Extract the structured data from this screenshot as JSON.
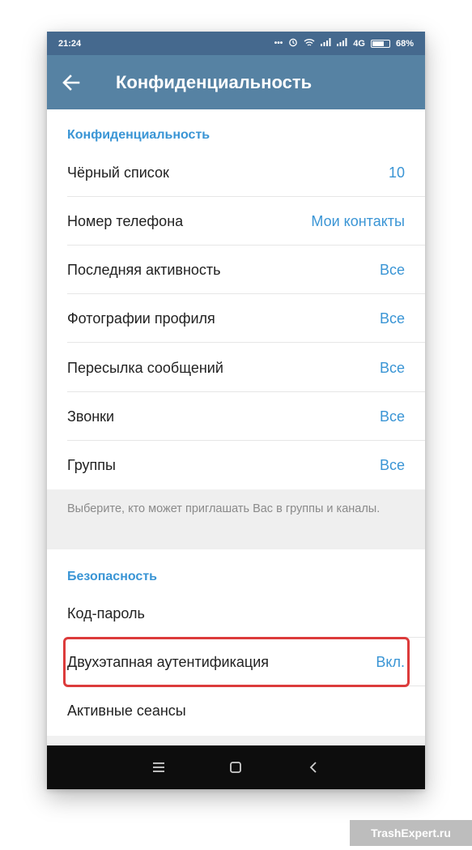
{
  "status_bar": {
    "time": "21:24",
    "icons": [
      "dots-icon",
      "alarm-icon",
      "wifi-icon",
      "signal-icon",
      "signal-icon"
    ],
    "network": "4G",
    "battery": "68%",
    "battery_level": 0.68
  },
  "app_bar": {
    "back_icon": "arrow-left-icon",
    "title": "Конфиденциальность"
  },
  "privacy": {
    "header": "Конфиденциальность",
    "rows": [
      {
        "label": "Чёрный список",
        "value": "10"
      },
      {
        "label": "Номер телефона",
        "value": "Мои контакты"
      },
      {
        "label": "Последняя активность",
        "value": "Все"
      },
      {
        "label": "Фотографии профиля",
        "value": "Все"
      },
      {
        "label": "Пересылка сообщений",
        "value": "Все"
      },
      {
        "label": "Звонки",
        "value": "Все"
      },
      {
        "label": "Группы",
        "value": "Все"
      }
    ],
    "hint": "Выберите, кто может приглашать Вас в группы и каналы."
  },
  "security": {
    "header": "Безопасность",
    "rows": [
      {
        "label": "Код-пароль",
        "value": ""
      },
      {
        "label": "Двухэтапная аутентификация",
        "value": "Вкл."
      },
      {
        "label": "Активные сеансы",
        "value": ""
      }
    ]
  },
  "nav_bar": {
    "icons": [
      "menu-icon",
      "home-icon",
      "back-icon"
    ]
  },
  "colors": {
    "status_bar": "#45698e",
    "app_bar": "#5682a3",
    "accent": "#3a95d5",
    "highlight": "#dc3b3b"
  },
  "watermark": "TrashExpert.ru"
}
